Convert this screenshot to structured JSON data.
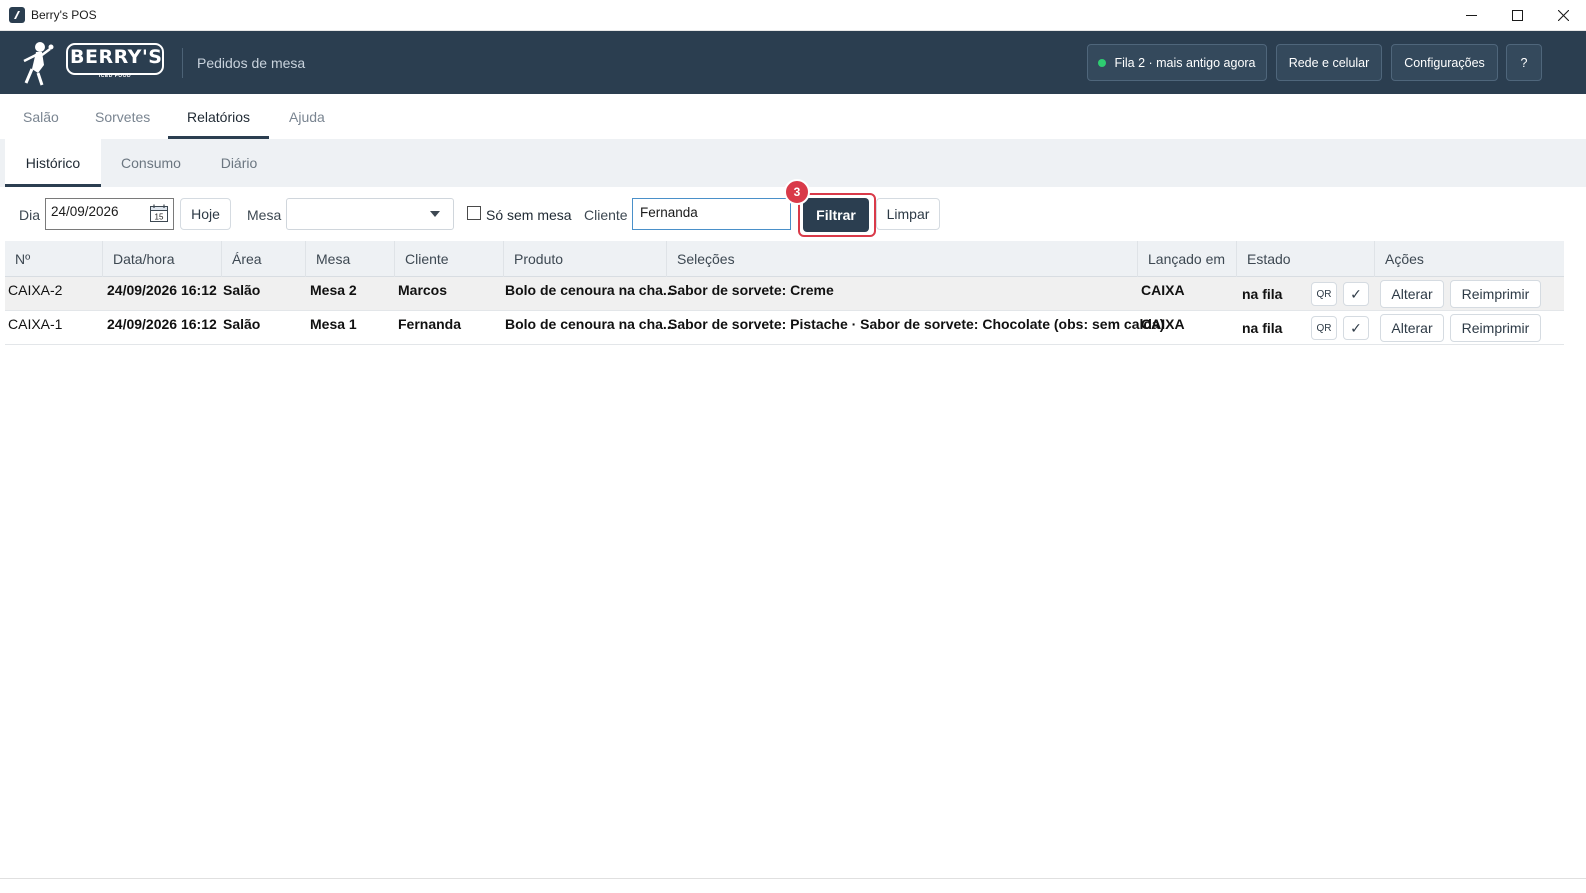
{
  "window": {
    "title": "Berry's POS"
  },
  "header": {
    "logo_text": "BERRY'S",
    "logo_subtext": "ICED FOOD",
    "subtitle": "Pedidos de mesa",
    "status_label": "Fila 2 · mais antigo agora",
    "status_color": "#2ecc71",
    "network_label": "Rede e celular",
    "settings_label": "Configurações",
    "help_label": "?"
  },
  "top_tabs": [
    {
      "label": "Salão",
      "active": false
    },
    {
      "label": "Sorvetes",
      "active": false
    },
    {
      "label": "Relatórios",
      "active": true
    },
    {
      "label": "Ajuda",
      "active": false
    }
  ],
  "sub_tabs": [
    {
      "label": "Histórico",
      "active": true
    },
    {
      "label": "Consumo",
      "active": false
    },
    {
      "label": "Diário",
      "active": false
    }
  ],
  "filters": {
    "day_label": "Dia",
    "day_value": "24/09/2026",
    "calendar_day": "15",
    "today_label": "Hoje",
    "table_label": "Mesa",
    "table_value": "",
    "no_table_label": "Só sem mesa",
    "no_table_checked": false,
    "client_label": "Cliente",
    "client_value": "Fernanda",
    "filter_label": "Filtrar",
    "clear_label": "Limpar",
    "step_badge": "3"
  },
  "table": {
    "columns": [
      "Nº",
      "Data/hora",
      "Área",
      "Mesa",
      "Cliente",
      "Produto",
      "Seleções",
      "Lançado em",
      "Estado",
      "Ações"
    ],
    "rows": [
      {
        "number": "CAIXA-2",
        "datetime": "24/09/2026 16:12",
        "area": "Salão",
        "table": "Mesa 2",
        "client": "Marcos",
        "product": "Bolo de cenoura na cha...",
        "selections": "Sabor de sorvete: Creme",
        "launched_at": "CAIXA",
        "state": "na fila",
        "qr_label": "QR",
        "check_label": "✓",
        "edit_label": "Alterar",
        "reprint_label": "Reimprimir"
      },
      {
        "number": "CAIXA-1",
        "datetime": "24/09/2026 16:12",
        "area": "Salão",
        "table": "Mesa 1",
        "client": "Fernanda",
        "product": "Bolo de cenoura na cha...",
        "selections": "Sabor de sorvete: Pistache · Sabor de sorvete: Chocolate (obs: sem calda)",
        "launched_at": "CAIXA",
        "state": "na fila",
        "qr_label": "QR",
        "check_label": "✓",
        "edit_label": "Alterar",
        "reprint_label": "Reimprimir"
      }
    ]
  },
  "colors": {
    "header_bg": "#2b3e50",
    "accent_red": "#d93a49"
  }
}
